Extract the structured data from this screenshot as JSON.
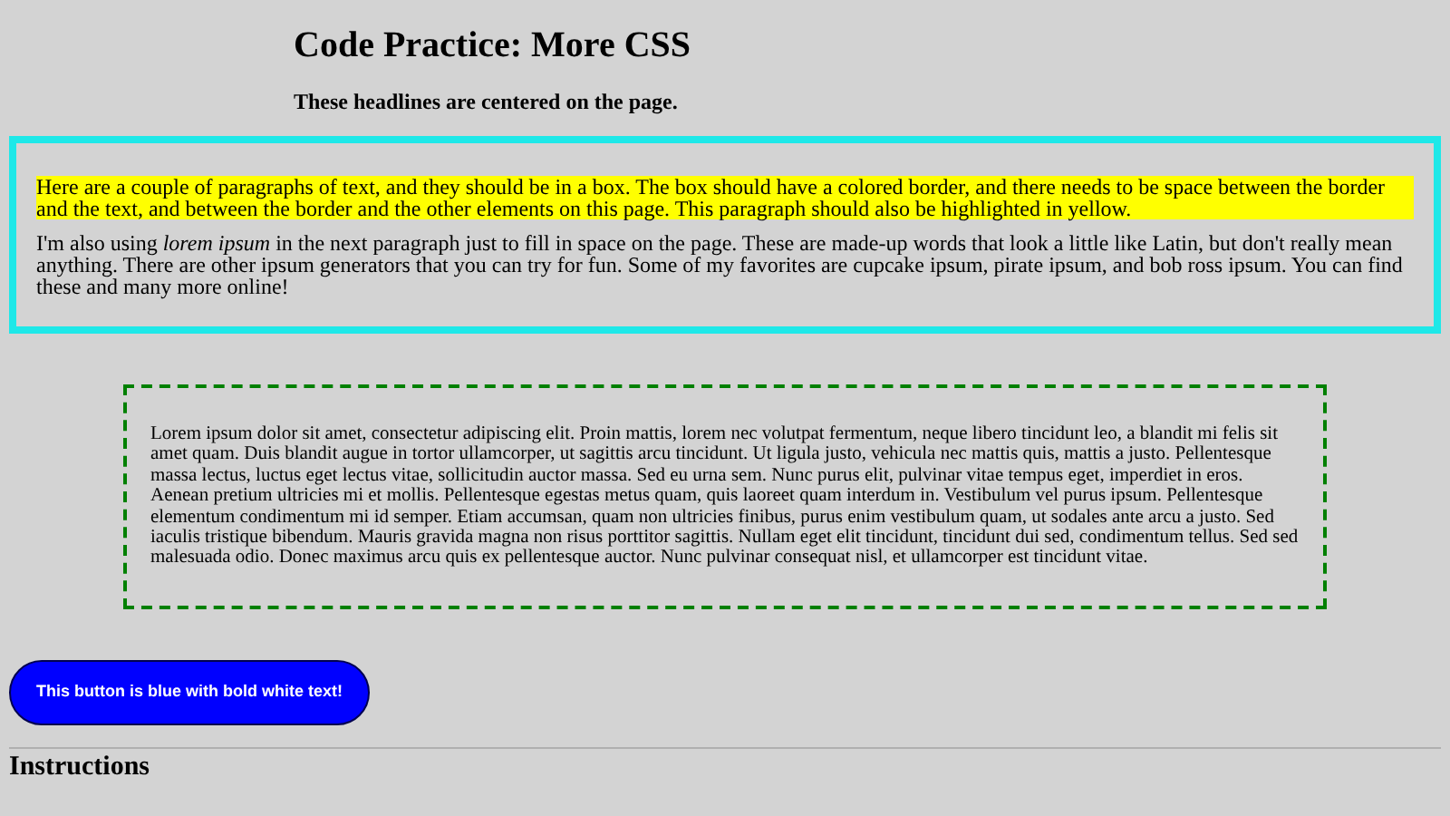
{
  "title": "Code Practice: More CSS",
  "subtitle": "These headlines are centered on the page.",
  "box": {
    "highlighted_paragraph": "Here are a couple of paragraphs of text, and they should be in a box. The box should have a colored border, and there needs to be space between the border and the text, and between the border and the other elements on this page. This paragraph should also be highlighted in yellow.",
    "paragraph": "I'm also using *lorem ipsum* in the next paragraph just to fill in space on the page. These are made-up words that look a little like Latin, but don't really mean anything. There are other ipsum generators that you can try for fun. Some of my favorites are cupcake ipsum, pirate ipsum, and bob ross ipsum. You can find these and many more online!"
  },
  "lorem_box": {
    "text": "Lorem ipsum dolor sit amet, consectetur adipiscing elit. Proin mattis, lorem nec volutpat fermentum, neque libero tincidunt leo, a blandit mi felis sit amet quam. Duis blandit augue in tortor ullamcorper, ut sagittis arcu tincidunt. Ut ligula justo, vehicula nec mattis quis, mattis a justo. Pellentesque massa lectus, luctus eget lectus vitae, sollicitudin auctor massa. Sed eu urna sem. Nunc purus elit, pulvinar vitae tempus eget, imperdiet in eros. Aenean pretium ultricies mi et mollis. Pellentesque egestas metus quam, quis laoreet quam interdum in. Vestibulum vel purus ipsum. Pellentesque elementum condimentum mi id semper. Etiam accumsan, quam non ultricies finibus, purus enim vestibulum quam, ut sodales ante arcu a justo. Sed iaculis tristique bibendum. Mauris gravida magna non risus porttitor sagittis. Nullam eget elit tincidunt, tincidunt dui sed, condimentum tellus. Sed sed malesuada odio. Donec maximus arcu quis ex pellentesque auctor. Nunc pulvinar consequat nisl, et ullamcorper est tincidunt vitae."
  },
  "button": "This button is blue with bold white text!",
  "section_heading": "Instructions"
}
